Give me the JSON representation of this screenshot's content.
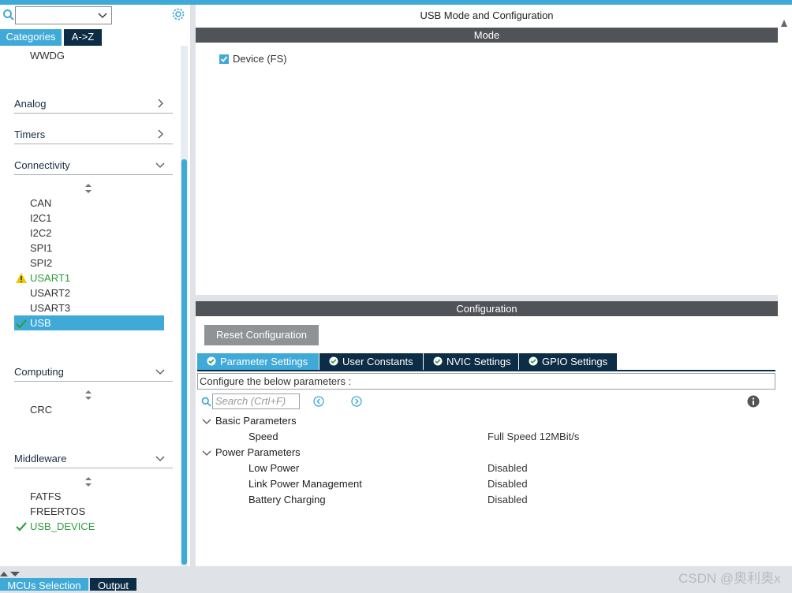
{
  "left_panel": {
    "tabs": {
      "categories": "Categories",
      "az": "A->Z"
    },
    "top_item": "WWDG",
    "categories": {
      "analog": "Analog",
      "timers": "Timers",
      "connectivity": "Connectivity",
      "computing": "Computing",
      "middleware": "Middleware"
    },
    "connectivity_items": [
      "CAN",
      "I2C1",
      "I2C2",
      "SPI1",
      "SPI2",
      "USART1",
      "USART2",
      "USART3",
      "USB"
    ],
    "computing_items": [
      "CRC"
    ],
    "middleware_items": [
      "FATFS",
      "FREERTOS",
      "USB_DEVICE"
    ]
  },
  "mode_panel": {
    "title": "USB Mode and Configuration",
    "mode_header": "Mode",
    "device_label": "Device (FS)",
    "device_checked": true
  },
  "config_panel": {
    "header": "Configuration",
    "reset_button": "Reset Configuration",
    "tabs": [
      "Parameter Settings",
      "User Constants",
      "NVIC Settings",
      "GPIO Settings"
    ],
    "instructions": "Configure the below parameters :",
    "search_placeholder": "Search (Crtl+F)",
    "groups": [
      {
        "name": "Basic Parameters",
        "params": [
          {
            "name": "Speed",
            "value": "Full Speed 12MBit/s"
          }
        ]
      },
      {
        "name": "Power Parameters",
        "params": [
          {
            "name": "Low Power",
            "value": "Disabled"
          },
          {
            "name": "Link Power Management",
            "value": "Disabled"
          },
          {
            "name": "Battery Charging",
            "value": "Disabled"
          }
        ]
      }
    ]
  },
  "bottom_tabs": {
    "mcu": "MCUs Selection",
    "output": "Output"
  },
  "watermark": "CSDN @奥利奥x",
  "colors": {
    "accent": "#3fa9d8",
    "dark_tab": "#0d2c46",
    "header_bar": "#505458",
    "ok_green": "#2e9e3f",
    "warning": "#f2c500"
  }
}
